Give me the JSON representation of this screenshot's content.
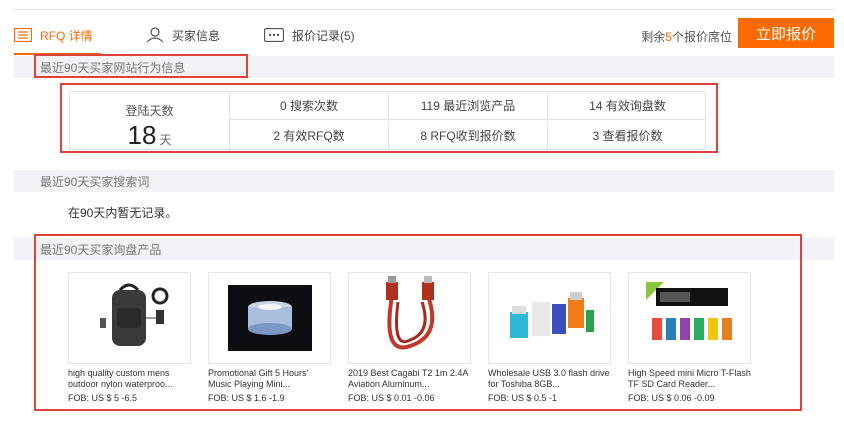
{
  "tabs": [
    {
      "label": "RFQ 详情",
      "active": true,
      "icon": "document-list-icon"
    },
    {
      "label": "买家信息",
      "active": false,
      "icon": "user-icon"
    },
    {
      "label": "报价记录(5)",
      "active": false,
      "icon": "chat-bubble-icon"
    }
  ],
  "header": {
    "remain_prefix": "剩余",
    "remain_count": "5",
    "remain_suffix": "个报价席位",
    "quote_button": "立即报价"
  },
  "behavior": {
    "title": "最近90天买家网站行为信息",
    "login_days_label": "登陆天数",
    "login_days_value": "18",
    "login_days_unit": "天",
    "cells": [
      "0 搜索次数",
      "119 最近浏览产品",
      "14 有效询盘数",
      "2 有效RFQ数",
      "8 RFQ收到报价数",
      "3 查看报价数"
    ]
  },
  "search": {
    "title": "最近90天买家搜索词",
    "empty_text": "在90天内暂无记录。"
  },
  "inquiry": {
    "title": "最近90天买家询盘产品",
    "products": [
      {
        "title": "high quality custom mens outdoor nylon waterproo...",
        "price": "FOB: US $ 5 -6.5"
      },
      {
        "title": "Promotional Gift 5 Hours' Music Playing Mini...",
        "price": "FOB: US $ 1.6 -1.9"
      },
      {
        "title": "2019 Best Cagabi T2 1m 2.4A Aviation Aluminum...",
        "price": "FOB: US $ 0.01 -0.06"
      },
      {
        "title": "Wholesale USB 3.0 flash drive for Toshiba 8GB...",
        "price": "FOB: US $ 0.5 -1"
      },
      {
        "title": "High Speed mini Micro T-Flash TF SD Card Reader...",
        "price": "FOB: US $ 0.06 -0.09"
      }
    ]
  },
  "colors": {
    "accent": "#ff6a00",
    "highlight_border": "#e0413a"
  }
}
